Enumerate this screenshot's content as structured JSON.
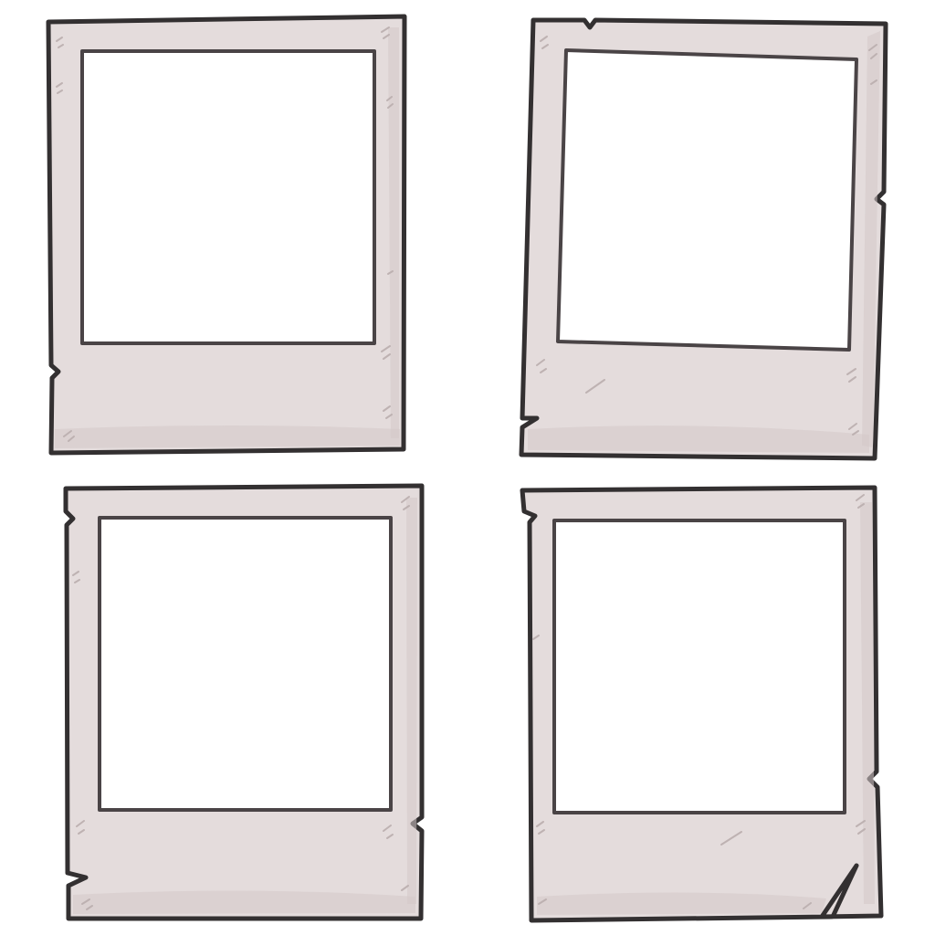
{
  "illustration": {
    "subject": "blank-polaroid-frames",
    "frame_count": 4,
    "colors": {
      "background": "#ffffff",
      "frame_fill": "#e4dcdc",
      "frame_shade": "#d3c9c9",
      "outline": "#333031",
      "inner_outline": "#4a4446",
      "photo_area": "#ffffff",
      "scuff": "#b9adad"
    },
    "frames": [
      {
        "id": "top-left",
        "photo": "blank"
      },
      {
        "id": "top-right",
        "photo": "blank"
      },
      {
        "id": "bottom-left",
        "photo": "blank"
      },
      {
        "id": "bottom-right",
        "photo": "blank"
      }
    ]
  }
}
